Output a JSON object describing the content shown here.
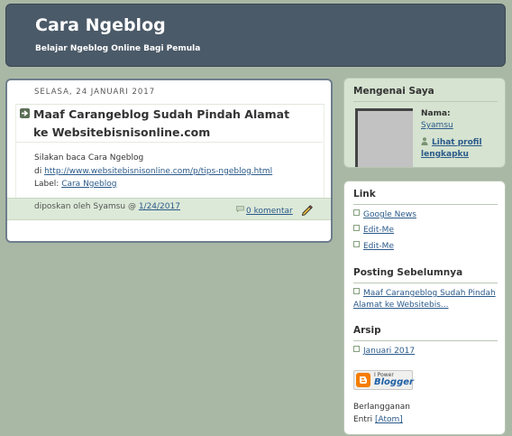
{
  "header": {
    "title": "Cara Ngeblog",
    "description": "Belajar Ngeblog Online Bagi Pemula"
  },
  "post": {
    "date": "SELASA, 24 JANUARI 2017",
    "title": "Maaf Carangeblog Sudah Pindah Alamat ke Websitebisnisonline.com",
    "body_line1": "Silakan baca Cara Ngeblog",
    "body_line2_prefix": "di ",
    "body_link": "http://www.websitebisnisonline.com/p/tips-ngeblog.html",
    "label_prefix": "Label: ",
    "label_link": "Cara Ngeblog",
    "footer_by": "diposkan oleh Syamsu @ ",
    "footer_time": "1/24/2017",
    "comments": "0 komentar"
  },
  "about": {
    "heading": "Mengenai Saya",
    "name_label": "Nama:",
    "name": "Syamsu",
    "profile_link": "Lihat profil lengkapku"
  },
  "sidebar": {
    "links_heading": "Link",
    "links": [
      "Google News",
      "Edit-Me",
      "Edit-Me"
    ],
    "recent_heading": "Posting Sebelumnya",
    "recent_post": "Maaf Carangeblog Sudah Pindah Alamat ke Websitebis...",
    "archive_heading": "Arsip",
    "archive_item": "Januari 2017",
    "powered_small": "I Power",
    "powered_brand": "Blogger",
    "subscribe_text": "Berlangganan",
    "subscribe_prefix": "Entri ",
    "subscribe_link": "[Atom]"
  },
  "colors": {
    "background": "#a9b8a5",
    "header": "#4b5a68",
    "post_footer": "#dce9d8",
    "about_box": "#d5e3d0",
    "link": "#2b5a8a"
  }
}
